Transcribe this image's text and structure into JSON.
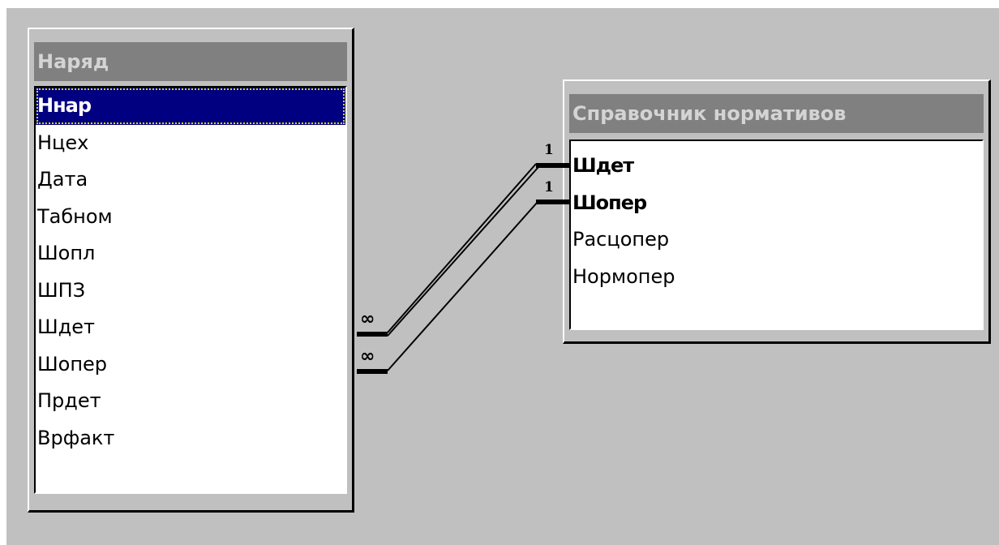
{
  "left_table": {
    "title": "Наряд",
    "fields": [
      {
        "label": "Ннар",
        "key": true,
        "selected": true
      },
      {
        "label": "Нцех",
        "key": false,
        "selected": false
      },
      {
        "label": "Дата",
        "key": false,
        "selected": false
      },
      {
        "label": "Табном",
        "key": false,
        "selected": false
      },
      {
        "label": "Шопл",
        "key": false,
        "selected": false
      },
      {
        "label": "ШПЗ",
        "key": false,
        "selected": false
      },
      {
        "label": "Шдет",
        "key": false,
        "selected": false
      },
      {
        "label": "Шопер",
        "key": false,
        "selected": false
      },
      {
        "label": "Прдет",
        "key": false,
        "selected": false
      },
      {
        "label": "Врфакт",
        "key": false,
        "selected": false
      }
    ]
  },
  "right_table": {
    "title": "Справочник нормативов",
    "fields": [
      {
        "label": "Шдет",
        "key": true,
        "selected": false
      },
      {
        "label": "Шопер",
        "key": true,
        "selected": false
      },
      {
        "label": "Расцопер",
        "key": false,
        "selected": false
      },
      {
        "label": "Нормопер",
        "key": false,
        "selected": false
      }
    ]
  },
  "relationships": [
    {
      "from_field": "Шдет",
      "to_field": "Шдет",
      "one_side": "1",
      "many_side": "∞"
    },
    {
      "from_field": "Шопер",
      "to_field": "Шопер",
      "one_side": "1",
      "many_side": "∞"
    }
  ],
  "colors": {
    "canvas": "#c0c0c0",
    "title_bar": "#808080",
    "title_text": "#d4d4d4",
    "selection": "#000080"
  }
}
